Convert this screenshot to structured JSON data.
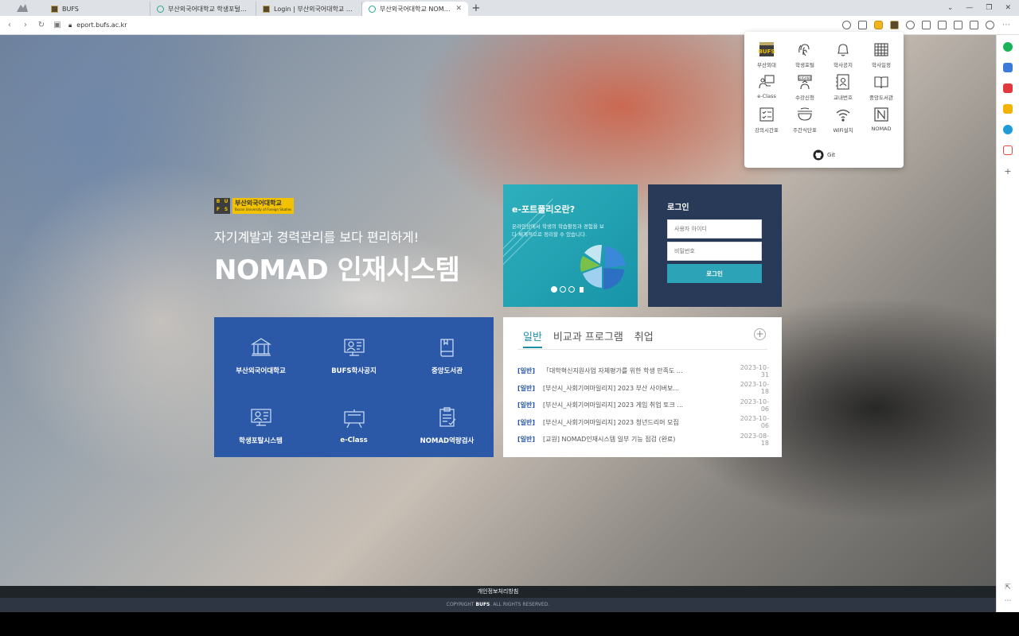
{
  "browser": {
    "tabs": [
      {
        "title": "BUFS",
        "favicon": "bufs-favicon"
      },
      {
        "title": "부산외국어대학교 학생포털시스",
        "favicon": "nomad-favicon"
      },
      {
        "title": "Login | 부산외국어대학교 수강신청",
        "favicon": "bufs-favicon"
      },
      {
        "title": "부산외국어대학교 NOMAD인재시스",
        "favicon": "nomad-favicon",
        "active": true
      }
    ],
    "url": "eport.bufs.ac.kr"
  },
  "brand": {
    "logo_mark": [
      "B",
      "U",
      "F",
      "S"
    ],
    "logo_korean": "부산외국어대학교",
    "logo_english": "Busan University of Foreign Studies",
    "tagline": "자기계발과 경력관리를 보다 편리하게!",
    "system_title": "NOMAD 인재시스템"
  },
  "eportfolio": {
    "title": "e-포트폴리오란?",
    "description": "온라인상에서 학생의 학습활동과 경험을 보다 체계적으로 정리할 수 있습니다."
  },
  "login": {
    "title": "로그인",
    "id_placeholder": "사용자 아이디",
    "pw_placeholder": "비밀번호",
    "button": "로그인"
  },
  "quick_links": [
    {
      "label": "부산외국어대학교",
      "icon": "university-icon"
    },
    {
      "label": "BUFS학사공지",
      "icon": "notice-board-icon"
    },
    {
      "label": "중앙도서관",
      "icon": "book-icon"
    },
    {
      "label": "학생포탈시스템",
      "icon": "id-card-icon"
    },
    {
      "label": "e-Class",
      "icon": "easel-icon"
    },
    {
      "label": "NOMAD역량검사",
      "icon": "checklist-icon"
    }
  ],
  "notice": {
    "tabs": [
      "일반",
      "비교과 프로그램",
      "취업"
    ],
    "items": [
      {
        "cat": "[일반]",
        "text": "「대학혁신지원사업 자체평가를 위한 학생 만족도 ...",
        "date": "2023-10-31"
      },
      {
        "cat": "[일반]",
        "text": "[부산시_사회기여마일리지] 2023 부산 사이버보...",
        "date": "2023-10-18"
      },
      {
        "cat": "[일반]",
        "text": "[부산시_사회기여마일리지] 2023 게임 취업 토크 ...",
        "date": "2023-10-06"
      },
      {
        "cat": "[일반]",
        "text": "[부산시_사회기여마일리지] 2023 청년드리머 모집",
        "date": "2023-10-06"
      },
      {
        "cat": "[일반]",
        "text": "[교원] NOMAD인재시스템 일부 기능 점검 (완료)",
        "date": "2023-08-18"
      }
    ]
  },
  "footer": {
    "privacy": "개인정보처리방침",
    "copyright_prefix": "COPYRIGHT",
    "copyright_brand": "BUFS",
    "copyright_suffix": ". ALL RIGHTS RESERVED."
  },
  "popup": {
    "items": [
      {
        "label": "부산외대",
        "icon": "bufs-logo-icon"
      },
      {
        "label": "학생포털",
        "icon": "fingerprint-icon"
      },
      {
        "label": "학사공지",
        "icon": "bell-icon"
      },
      {
        "label": "학사일정",
        "icon": "calendar-icon"
      },
      {
        "label": "e-Class",
        "icon": "presenter-icon"
      },
      {
        "label": "수강신청",
        "icon": "sugang-icon"
      },
      {
        "label": "교내번호",
        "icon": "contacts-icon"
      },
      {
        "label": "중앙도서관",
        "icon": "open-book-icon"
      },
      {
        "label": "강의시간표",
        "icon": "timetable-icon"
      },
      {
        "label": "주간식단표",
        "icon": "meal-bowl-icon"
      },
      {
        "label": "WiFi설치",
        "icon": "wifi-icon"
      },
      {
        "label": "NOMAD",
        "icon": "nomad-n-icon"
      }
    ],
    "git_label": "Git",
    "sugang_badge": "SUGANG"
  },
  "colors": {
    "brand_blue": "#2b58a7",
    "teal": "#2da3b8",
    "navy": "#283a57",
    "gold": "#f2c200"
  }
}
